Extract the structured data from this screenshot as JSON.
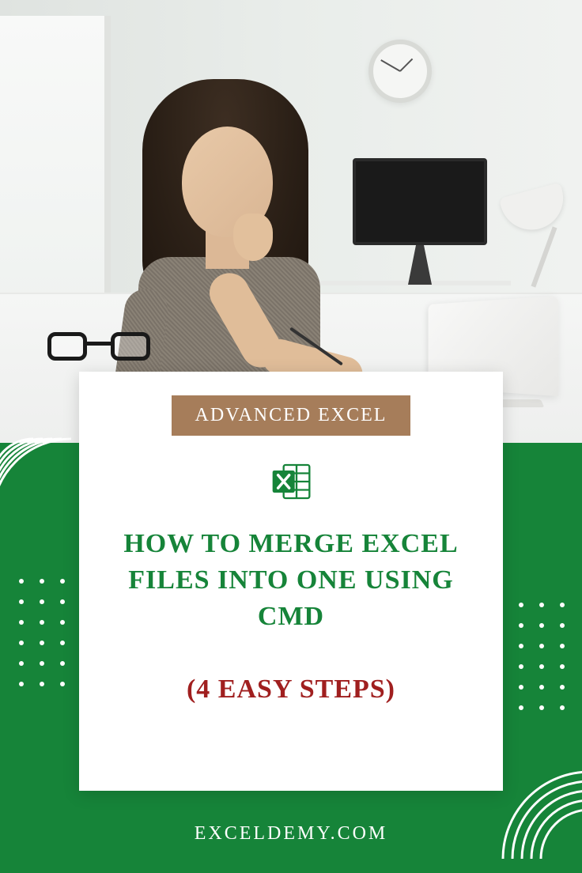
{
  "card": {
    "category": "ADVANCED EXCEL",
    "icon_name": "excel-icon",
    "title": "HOW TO MERGE EXCEL FILES INTO ONE USING CMD",
    "subtitle": "(4 EASY STEPS)"
  },
  "footer": {
    "site": "EXCELDEMY.COM"
  },
  "colors": {
    "brand_green": "#168439",
    "badge_brown": "#a67d5a",
    "accent_red": "#a01f1f"
  }
}
